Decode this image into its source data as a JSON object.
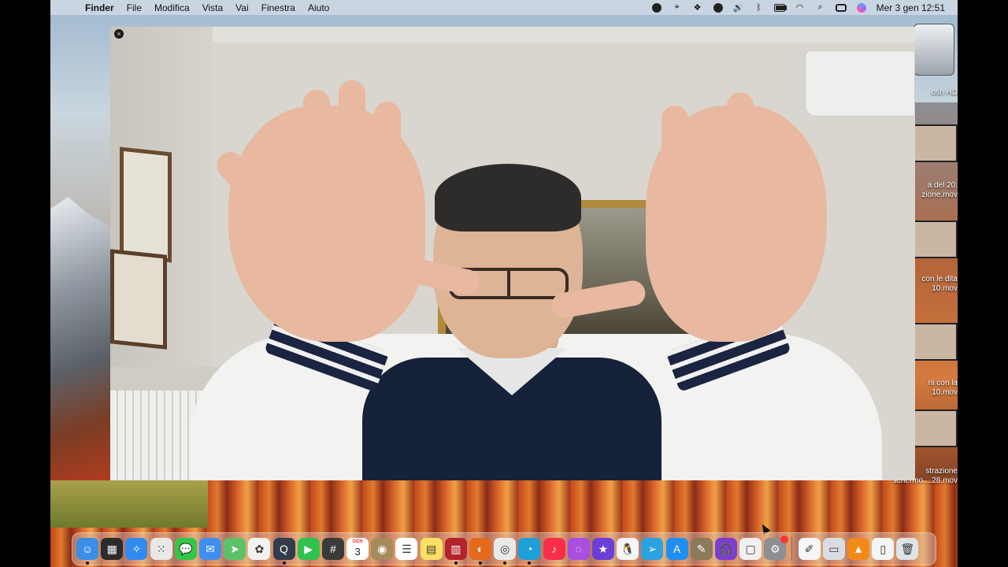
{
  "menubar": {
    "app_name": "Finder",
    "menus": [
      "File",
      "Modifica",
      "Vista",
      "Vai",
      "Finestra",
      "Aiuto"
    ],
    "clock": "Mer 3 gen  12:51"
  },
  "desktop": {
    "items": [
      {
        "label": "osh HD"
      },
      {
        "label": "a del 20.\nzione.mov"
      },
      {
        "label": "con le dita\n10.mov"
      },
      {
        "label": "ni con la\n10.mov"
      },
      {
        "label": "strazione\nschermo....28.mov"
      }
    ]
  },
  "video": {
    "close_symbol": "×"
  },
  "dock": {
    "calendar_month": "GEN",
    "calendar_day": "3",
    "apps": [
      {
        "name": "finder",
        "color": "#3a8ee6",
        "glyph": "☺",
        "running": true
      },
      {
        "name": "launchpad",
        "color": "#2b2b2b",
        "glyph": "▦",
        "running": false
      },
      {
        "name": "safari",
        "color": "#2f8bf0",
        "glyph": "✧",
        "running": false
      },
      {
        "name": "launchpad-grid",
        "color": "#e8e8e8",
        "glyph": "⁙",
        "running": false
      },
      {
        "name": "messages",
        "color": "#33c748",
        "glyph": "💬",
        "running": false
      },
      {
        "name": "mail",
        "color": "#3f8ff0",
        "glyph": "✉",
        "running": false
      },
      {
        "name": "maps",
        "color": "#5ac36a",
        "glyph": "➤",
        "running": false
      },
      {
        "name": "photos",
        "color": "#f2f2f2",
        "glyph": "✿",
        "running": false
      },
      {
        "name": "quicktime",
        "color": "#333c4a",
        "glyph": "Q",
        "running": true
      },
      {
        "name": "facetime",
        "color": "#31c24d",
        "glyph": "▶",
        "running": false
      },
      {
        "name": "calculator",
        "color": "#3a3a3a",
        "glyph": "#",
        "running": false
      },
      {
        "name": "calendar",
        "color": "#ffffff",
        "glyph": "",
        "running": false
      },
      {
        "name": "disk-utility",
        "color": "#a68a5a",
        "glyph": "◉",
        "running": false
      },
      {
        "name": "reminders",
        "color": "#ffffff",
        "glyph": "☰",
        "running": false
      },
      {
        "name": "notes",
        "color": "#ffe066",
        "glyph": "▤",
        "running": false
      },
      {
        "name": "photo-booth",
        "color": "#b3232a",
        "glyph": "▥",
        "running": true
      },
      {
        "name": "firefox",
        "color": "#e56a1e",
        "glyph": "◐",
        "running": true
      },
      {
        "name": "chrome",
        "color": "#e9e9e9",
        "glyph": "◎",
        "running": true
      },
      {
        "name": "edge",
        "color": "#1f9fd8",
        "glyph": "◔",
        "running": true
      },
      {
        "name": "music",
        "color": "#fa2d48",
        "glyph": "♪",
        "running": false
      },
      {
        "name": "podcasts",
        "color": "#a94ee0",
        "glyph": "◌",
        "running": false
      },
      {
        "name": "imovie",
        "color": "#6b3fd6",
        "glyph": "★",
        "running": false
      },
      {
        "name": "linux-penguin",
        "color": "#f5f5f5",
        "glyph": "🐧",
        "running": false
      },
      {
        "name": "telegram",
        "color": "#2aa3e0",
        "glyph": "➢",
        "running": false
      },
      {
        "name": "app-store",
        "color": "#1e8ff1",
        "glyph": "A",
        "running": false
      },
      {
        "name": "gimp",
        "color": "#8c7a5a",
        "glyph": "✎",
        "running": false
      },
      {
        "name": "headphones-app",
        "color": "#7b3fd0",
        "glyph": "🎧",
        "running": false
      },
      {
        "name": "preview",
        "color": "#f0f0f0",
        "glyph": "▢",
        "running": false
      },
      {
        "name": "system-preferences",
        "color": "#8e8e93",
        "glyph": "⚙",
        "running": false
      }
    ],
    "extras": [
      {
        "name": "textedit",
        "color": "#f6f6f6",
        "glyph": "✐"
      },
      {
        "name": "screenshot-app",
        "color": "#d9dde3",
        "glyph": "▭"
      },
      {
        "name": "vlc",
        "color": "#f28a1a",
        "glyph": "▲"
      },
      {
        "name": "document",
        "color": "#f5f5f5",
        "glyph": "▯"
      },
      {
        "name": "trash",
        "color": "#dfe3e6",
        "glyph": "🗑"
      }
    ]
  }
}
